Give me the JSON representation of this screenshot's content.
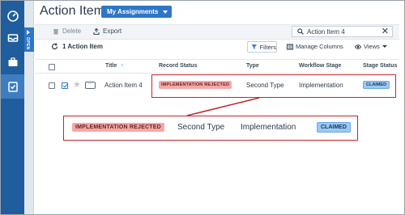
{
  "nav": {
    "items": [
      {
        "icon": "dashboard-icon"
      },
      {
        "icon": "inbox-icon"
      },
      {
        "icon": "briefcase-icon"
      },
      {
        "icon": "checklist-icon"
      }
    ],
    "open_label": "OPEN"
  },
  "header": {
    "title": "Action Items",
    "assignments_label": "My Assignments"
  },
  "toolbar": {
    "delete_label": "Delete",
    "export_label": "Export",
    "search_value": "Action Item 4"
  },
  "summary": {
    "count_label": "1 Action Item",
    "filters_label": "Filters",
    "manage_columns_label": "Manage Columns",
    "views_label": "Views"
  },
  "table": {
    "columns": {
      "title": "Title",
      "sort_indicator": "↑",
      "record_status": "Record Status",
      "type": "Type",
      "workflow_stage": "Workflow Stage",
      "stage_status": "Stage Status"
    },
    "row": {
      "more_label": "···",
      "title": "Action Item 4",
      "record_status": "IMPLEMENTATION REJECTED",
      "type": "Second Type",
      "workflow_stage": "Implementation",
      "stage_status": "CLAIMED"
    }
  },
  "callout": {
    "record_status": "IMPLEMENTATION REJECTED",
    "type": "Second Type",
    "workflow_stage": "Implementation",
    "stage_status": "CLAIMED"
  },
  "colors": {
    "nav": "#1f5d9c",
    "accent": "#2f76c8",
    "highlight": "#c0272d",
    "rejected_badge": "#f4a9a8",
    "claimed_badge": "#9cc9f2"
  }
}
